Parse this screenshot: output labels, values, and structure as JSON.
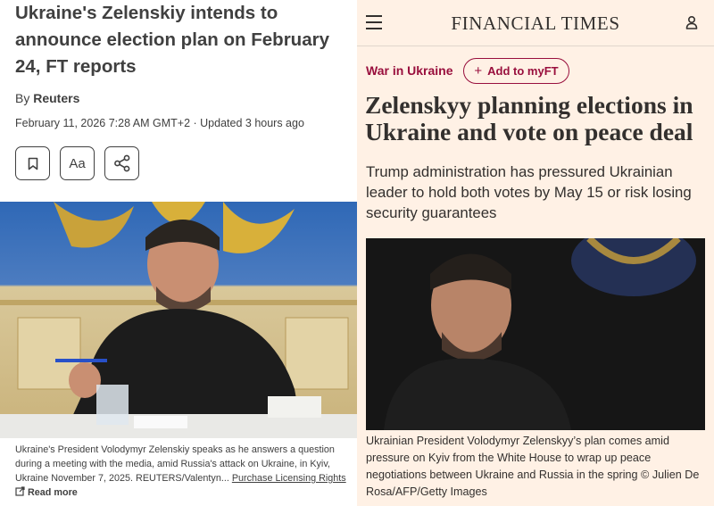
{
  "reuters": {
    "headline": "Ukraine's Zelenskiy intends to announce election plan on February 24, FT reports",
    "byline_prefix": "By",
    "byline_author": "Reuters",
    "date": "February 11, 2026 7:28 AM GMT+2 · Updated 3 hours ago",
    "text_size_label": "Aa",
    "caption": "Ukraine's President Volodymyr Zelenskiy speaks as he answers a question during a meeting with the media, amid Russia's attack on Ukraine, in Kyiv, Ukraine November 7, 2025. REUTERS/Valentyn... ",
    "caption_link": "Purchase Licensing Rights",
    "read_more": "Read more"
  },
  "ft": {
    "logo": "FINANCIAL TIMES",
    "topic": "War in Ukraine",
    "add_button": "Add to myFT",
    "headline": "Zelenskyy planning elections in Ukraine and vote on peace deal",
    "standfirst": "Trump administration has pressured Ukrainian leader to hold both votes by May 15 or risk losing security guarantees",
    "caption": "Ukrainian President Volodymyr Zelenskyy’s plan comes amid pressure on Kyiv from the White House to wrap up peace negotiations between Ukraine and Russia in the spring © Julien De Rosa/AFP/Getty Images"
  },
  "colors": {
    "ft_background": "#fff1e5",
    "ft_claret": "#990f3d",
    "reuters_text": "#404040"
  },
  "icons": [
    "bookmark-icon",
    "share-icon",
    "menu-icon",
    "user-icon",
    "plus-icon",
    "external-link-icon"
  ]
}
